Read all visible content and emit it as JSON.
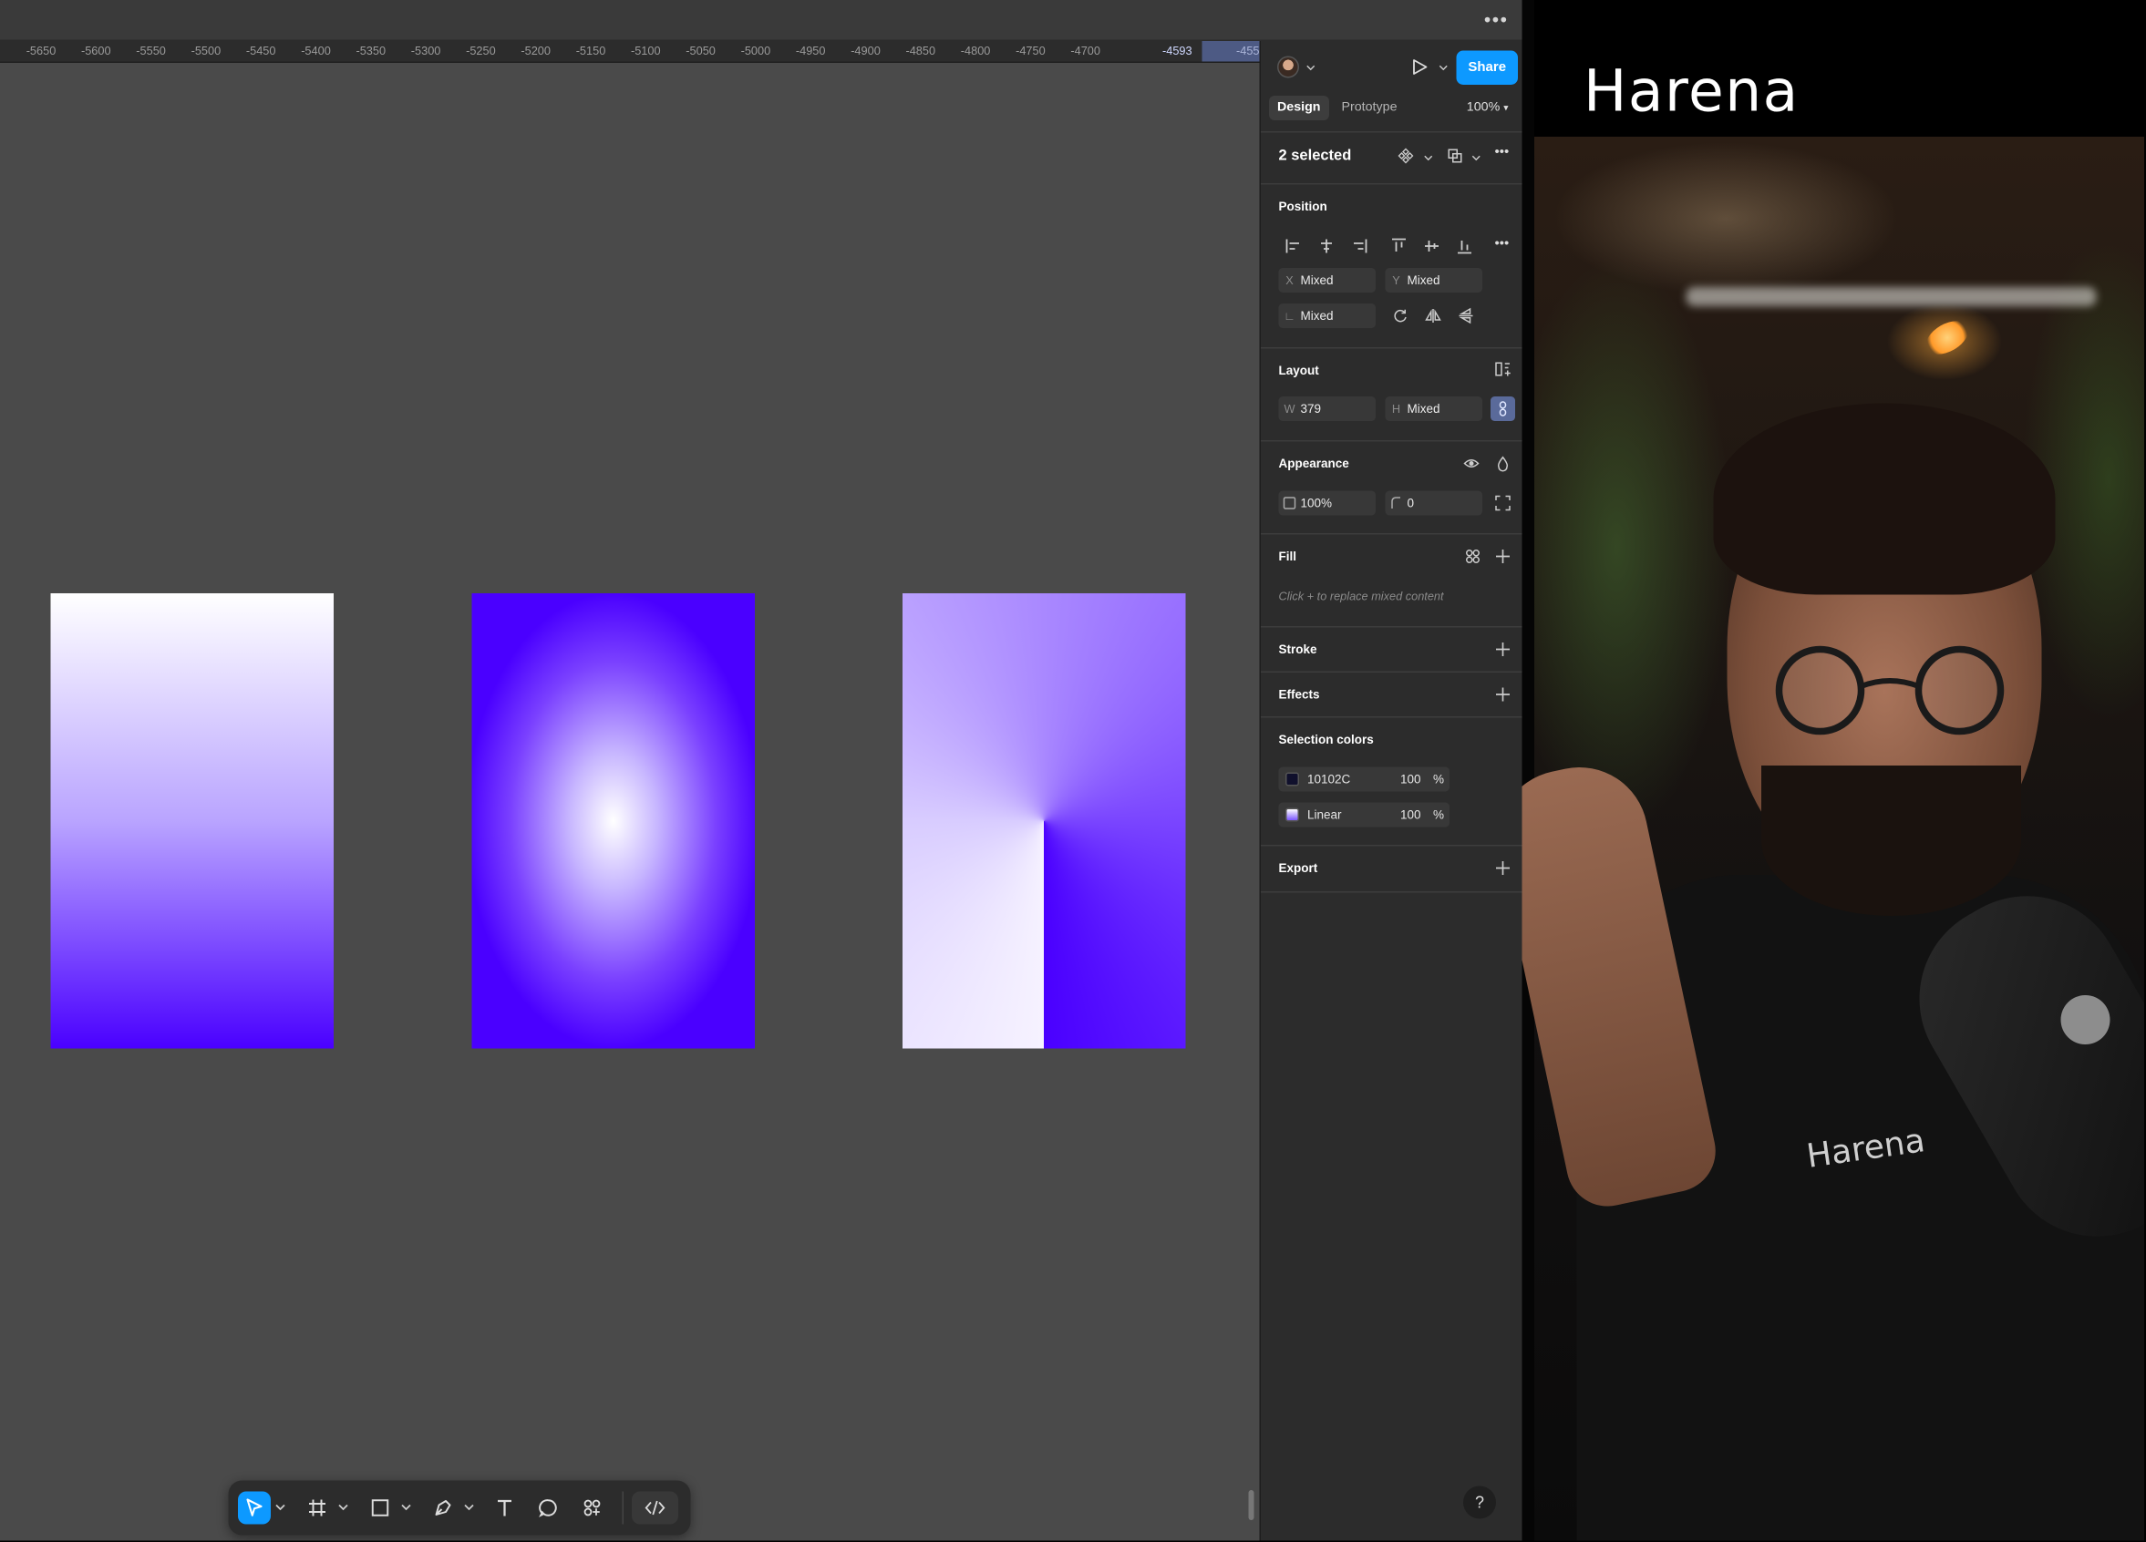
{
  "canvas": {
    "ruler_ticks": [
      "-5650",
      "-5600",
      "-5550",
      "-5500",
      "-5450",
      "-5400",
      "-5350",
      "-5300",
      "-5250",
      "-5200",
      "-5150",
      "-5100",
      "-5050",
      "-5000",
      "-4950",
      "-4900",
      "-4850",
      "-4800",
      "-4750",
      "-4700"
    ],
    "ruler_marker_primary": "-4593",
    "ruler_marker_secondary": "-455",
    "frames": [
      "linear",
      "radial",
      "angular"
    ],
    "gradient_colors": {
      "light": "#ffffff",
      "purple": "#4a00ff"
    }
  },
  "toolbar": {
    "tools": [
      "move",
      "frame",
      "rectangle",
      "pen",
      "text",
      "comment",
      "components",
      "dev-mode"
    ],
    "active_tool": "move",
    "accent": "#0d99ff"
  },
  "panel": {
    "share_label": "Share",
    "tabs": [
      "Design",
      "Prototype"
    ],
    "zoom": "100%",
    "selection_title": "2 selected",
    "position": {
      "title": "Position",
      "x_label": "X",
      "x_value": "Mixed",
      "y_label": "Y",
      "y_value": "Mixed",
      "rotation_label": "∟",
      "rotation_value": "Mixed"
    },
    "layout": {
      "title": "Layout",
      "w_label": "W",
      "w_value": "379",
      "h_label": "H",
      "h_value": "Mixed"
    },
    "appearance": {
      "title": "Appearance",
      "opacity": "100%",
      "radius": "0"
    },
    "fill": {
      "title": "Fill",
      "hint": "Click + to replace mixed content"
    },
    "stroke_title": "Stroke",
    "effects_title": "Effects",
    "selection_colors": {
      "title": "Selection colors",
      "items": [
        {
          "label": "10102C",
          "opacity": "100",
          "unit": "%",
          "swatch": "#10102c"
        },
        {
          "label": "Linear",
          "opacity": "100",
          "unit": "%",
          "swatch": "#7a55ff"
        }
      ]
    },
    "export_title": "Export",
    "help": "?"
  },
  "overlay": {
    "brand": "Harena",
    "shirt_text": "Harena"
  }
}
